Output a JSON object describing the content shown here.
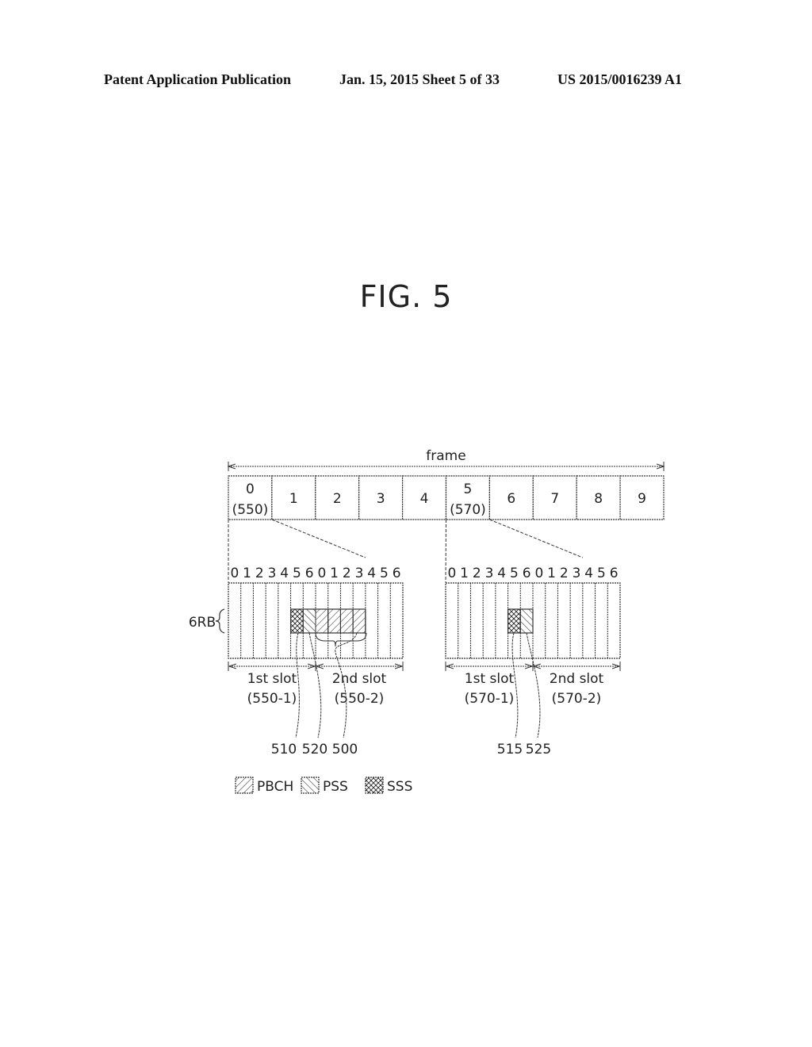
{
  "header": {
    "left": "Patent Application Publication",
    "middle": "Jan. 15, 2015  Sheet 5 of 33",
    "right": "US 2015/0016239 A1"
  },
  "figure": {
    "title": "FIG. 5",
    "frame_label": "frame",
    "subframes": [
      {
        "index": "0",
        "ref": "(550)"
      },
      {
        "index": "1",
        "ref": ""
      },
      {
        "index": "2",
        "ref": ""
      },
      {
        "index": "3",
        "ref": ""
      },
      {
        "index": "4",
        "ref": ""
      },
      {
        "index": "5",
        "ref": "(570)"
      },
      {
        "index": "6",
        "ref": ""
      },
      {
        "index": "7",
        "ref": ""
      },
      {
        "index": "8",
        "ref": ""
      },
      {
        "index": "9",
        "ref": ""
      }
    ],
    "rb_label": "6RB",
    "symbol_labels": [
      "0",
      "1",
      "2",
      "3",
      "4",
      "5",
      "6",
      "0",
      "1",
      "2",
      "3",
      "4",
      "5",
      "6"
    ],
    "expanded": [
      {
        "subframe": "0",
        "slots": [
          {
            "name": "1st slot",
            "ref": "(550-1)"
          },
          {
            "name": "2nd slot",
            "ref": "(550-2)"
          }
        ],
        "signals": [
          {
            "symbol": 5,
            "type": "SSS"
          },
          {
            "symbol": 6,
            "type": "PSS"
          },
          {
            "symbol": 7,
            "type": "PBCH"
          },
          {
            "symbol": 8,
            "type": "PBCH"
          },
          {
            "symbol": 9,
            "type": "PBCH"
          },
          {
            "symbol": 10,
            "type": "PBCH"
          }
        ],
        "refs": [
          "510",
          "520",
          "500"
        ]
      },
      {
        "subframe": "5",
        "slots": [
          {
            "name": "1st slot",
            "ref": "(570-1)"
          },
          {
            "name": "2nd slot",
            "ref": "(570-2)"
          }
        ],
        "signals": [
          {
            "symbol": 5,
            "type": "SSS"
          },
          {
            "symbol": 6,
            "type": "PSS"
          }
        ],
        "refs": [
          "515",
          "525"
        ]
      }
    ],
    "legend": [
      {
        "pattern": "PBCH",
        "label": "PBCH"
      },
      {
        "pattern": "PSS",
        "label": "PSS"
      },
      {
        "pattern": "SSS",
        "label": "SSS"
      }
    ]
  }
}
